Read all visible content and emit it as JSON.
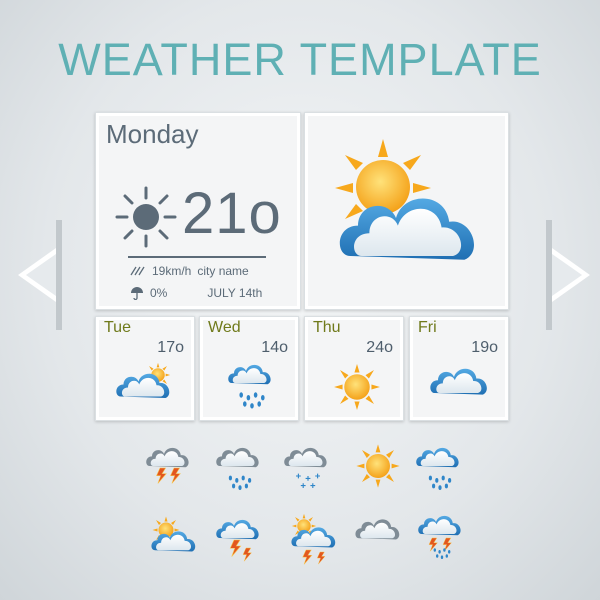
{
  "title": "WEATHER TEMPLATE",
  "main": {
    "day": "Monday",
    "temperature": "21o",
    "wind": "19km/h",
    "city": "city name",
    "rain": "0%",
    "date": "JULY 14th",
    "icon": "sun-cloud-icon"
  },
  "forecast": [
    {
      "day": "Tue",
      "temp": "17o",
      "icon": "cloud-sun-icon"
    },
    {
      "day": "Wed",
      "temp": "14o",
      "icon": "rain-cloud-icon"
    },
    {
      "day": "Thu",
      "temp": "24o",
      "icon": "sun-icon"
    },
    {
      "day": "Fri",
      "temp": "19o",
      "icon": "cloud-icon"
    }
  ],
  "icon_set": [
    "storm-cloud-icon",
    "snow-cloud-icon",
    "snowflake-cloud-icon",
    "sun-icon",
    "rain-cloud-icon",
    "sun-cloud-icon",
    "lightning-cloud-icon",
    "sun-storm-cloud-icon",
    "cloud-icon",
    "rain-storm-cloud-icon"
  ],
  "colors": {
    "title": "#5fb0b4",
    "text": "#5c6b78",
    "day_label": "#6f7a1b",
    "sun": "#f5a623",
    "cloud": "#2f86c9",
    "bolt": "#d9531e"
  }
}
